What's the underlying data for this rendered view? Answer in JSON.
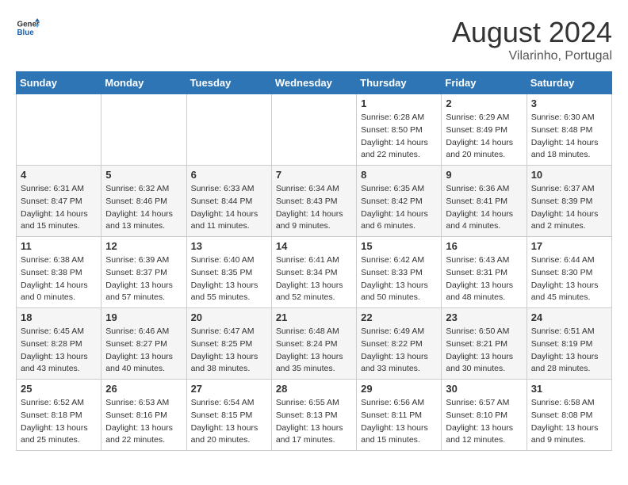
{
  "header": {
    "logo_general": "General",
    "logo_blue": "Blue",
    "month_title": "August 2024",
    "location": "Vilarinho, Portugal"
  },
  "weekdays": [
    "Sunday",
    "Monday",
    "Tuesday",
    "Wednesday",
    "Thursday",
    "Friday",
    "Saturday"
  ],
  "weeks": [
    [
      {
        "day": "",
        "info": ""
      },
      {
        "day": "",
        "info": ""
      },
      {
        "day": "",
        "info": ""
      },
      {
        "day": "",
        "info": ""
      },
      {
        "day": "1",
        "info": "Sunrise: 6:28 AM\nSunset: 8:50 PM\nDaylight: 14 hours\nand 22 minutes."
      },
      {
        "day": "2",
        "info": "Sunrise: 6:29 AM\nSunset: 8:49 PM\nDaylight: 14 hours\nand 20 minutes."
      },
      {
        "day": "3",
        "info": "Sunrise: 6:30 AM\nSunset: 8:48 PM\nDaylight: 14 hours\nand 18 minutes."
      }
    ],
    [
      {
        "day": "4",
        "info": "Sunrise: 6:31 AM\nSunset: 8:47 PM\nDaylight: 14 hours\nand 15 minutes."
      },
      {
        "day": "5",
        "info": "Sunrise: 6:32 AM\nSunset: 8:46 PM\nDaylight: 14 hours\nand 13 minutes."
      },
      {
        "day": "6",
        "info": "Sunrise: 6:33 AM\nSunset: 8:44 PM\nDaylight: 14 hours\nand 11 minutes."
      },
      {
        "day": "7",
        "info": "Sunrise: 6:34 AM\nSunset: 8:43 PM\nDaylight: 14 hours\nand 9 minutes."
      },
      {
        "day": "8",
        "info": "Sunrise: 6:35 AM\nSunset: 8:42 PM\nDaylight: 14 hours\nand 6 minutes."
      },
      {
        "day": "9",
        "info": "Sunrise: 6:36 AM\nSunset: 8:41 PM\nDaylight: 14 hours\nand 4 minutes."
      },
      {
        "day": "10",
        "info": "Sunrise: 6:37 AM\nSunset: 8:39 PM\nDaylight: 14 hours\nand 2 minutes."
      }
    ],
    [
      {
        "day": "11",
        "info": "Sunrise: 6:38 AM\nSunset: 8:38 PM\nDaylight: 14 hours\nand 0 minutes."
      },
      {
        "day": "12",
        "info": "Sunrise: 6:39 AM\nSunset: 8:37 PM\nDaylight: 13 hours\nand 57 minutes."
      },
      {
        "day": "13",
        "info": "Sunrise: 6:40 AM\nSunset: 8:35 PM\nDaylight: 13 hours\nand 55 minutes."
      },
      {
        "day": "14",
        "info": "Sunrise: 6:41 AM\nSunset: 8:34 PM\nDaylight: 13 hours\nand 52 minutes."
      },
      {
        "day": "15",
        "info": "Sunrise: 6:42 AM\nSunset: 8:33 PM\nDaylight: 13 hours\nand 50 minutes."
      },
      {
        "day": "16",
        "info": "Sunrise: 6:43 AM\nSunset: 8:31 PM\nDaylight: 13 hours\nand 48 minutes."
      },
      {
        "day": "17",
        "info": "Sunrise: 6:44 AM\nSunset: 8:30 PM\nDaylight: 13 hours\nand 45 minutes."
      }
    ],
    [
      {
        "day": "18",
        "info": "Sunrise: 6:45 AM\nSunset: 8:28 PM\nDaylight: 13 hours\nand 43 minutes."
      },
      {
        "day": "19",
        "info": "Sunrise: 6:46 AM\nSunset: 8:27 PM\nDaylight: 13 hours\nand 40 minutes."
      },
      {
        "day": "20",
        "info": "Sunrise: 6:47 AM\nSunset: 8:25 PM\nDaylight: 13 hours\nand 38 minutes."
      },
      {
        "day": "21",
        "info": "Sunrise: 6:48 AM\nSunset: 8:24 PM\nDaylight: 13 hours\nand 35 minutes."
      },
      {
        "day": "22",
        "info": "Sunrise: 6:49 AM\nSunset: 8:22 PM\nDaylight: 13 hours\nand 33 minutes."
      },
      {
        "day": "23",
        "info": "Sunrise: 6:50 AM\nSunset: 8:21 PM\nDaylight: 13 hours\nand 30 minutes."
      },
      {
        "day": "24",
        "info": "Sunrise: 6:51 AM\nSunset: 8:19 PM\nDaylight: 13 hours\nand 28 minutes."
      }
    ],
    [
      {
        "day": "25",
        "info": "Sunrise: 6:52 AM\nSunset: 8:18 PM\nDaylight: 13 hours\nand 25 minutes."
      },
      {
        "day": "26",
        "info": "Sunrise: 6:53 AM\nSunset: 8:16 PM\nDaylight: 13 hours\nand 22 minutes."
      },
      {
        "day": "27",
        "info": "Sunrise: 6:54 AM\nSunset: 8:15 PM\nDaylight: 13 hours\nand 20 minutes."
      },
      {
        "day": "28",
        "info": "Sunrise: 6:55 AM\nSunset: 8:13 PM\nDaylight: 13 hours\nand 17 minutes."
      },
      {
        "day": "29",
        "info": "Sunrise: 6:56 AM\nSunset: 8:11 PM\nDaylight: 13 hours\nand 15 minutes."
      },
      {
        "day": "30",
        "info": "Sunrise: 6:57 AM\nSunset: 8:10 PM\nDaylight: 13 hours\nand 12 minutes."
      },
      {
        "day": "31",
        "info": "Sunrise: 6:58 AM\nSunset: 8:08 PM\nDaylight: 13 hours\nand 9 minutes."
      }
    ]
  ]
}
